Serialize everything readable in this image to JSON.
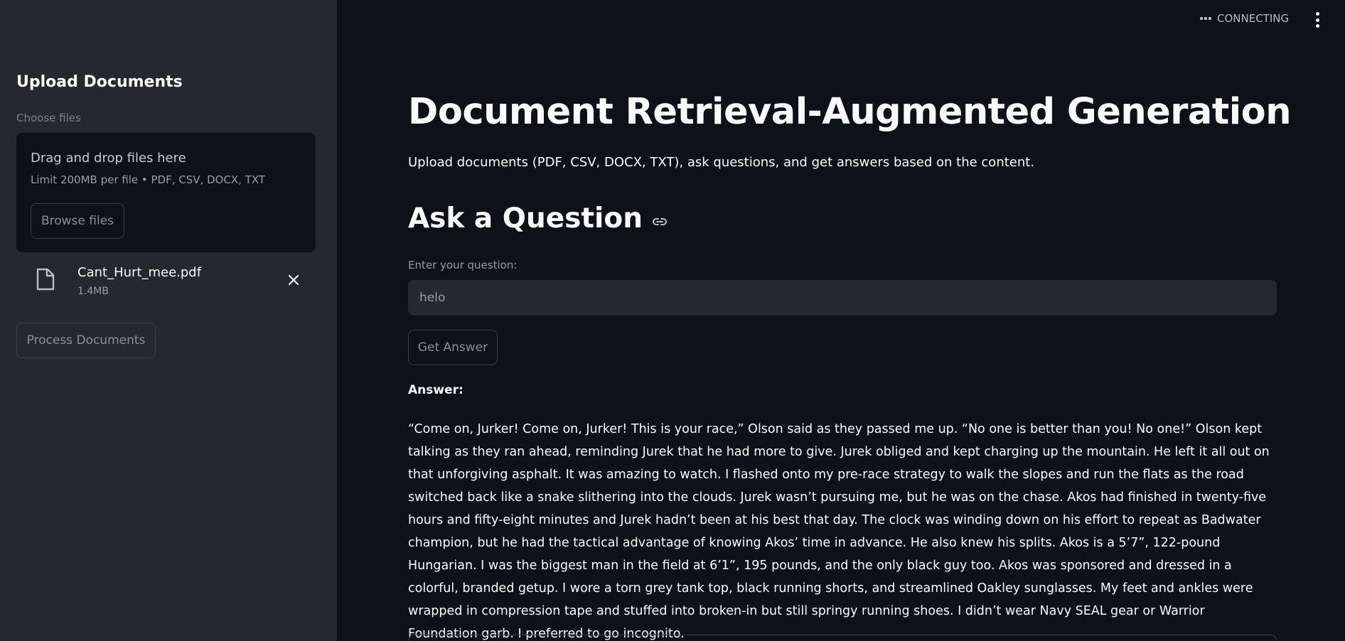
{
  "sidebar": {
    "title": "Upload Documents",
    "uploader_label": "Choose files",
    "dropzone": {
      "title": "Drag and drop files here",
      "subtitle": "Limit 200MB per file • PDF, CSV, DOCX, TXT",
      "browse_label": "Browse files"
    },
    "file": {
      "name": "Cant_Hurt_mee.pdf",
      "size": "1.4MB",
      "icon": "file-icon"
    },
    "process_label": "Process Documents"
  },
  "topbar": {
    "status": "CONNECTING"
  },
  "main": {
    "title": "Document Retrieval-Augmented Generation",
    "description": "Upload documents (PDF, CSV, DOCX, TXT), ask questions, and get answers based on the content.",
    "section_title": "Ask a Question",
    "question_label": "Enter your question:",
    "question_value": "helo",
    "get_answer_label": "Get Answer",
    "answer_label": "Answer:",
    "answer_text": "“Come on, Jurker! Come on, Jurker! This is your race,” Olson said as they passed me up. “No one is better than you! No one!” Olson kept talking as they ran ahead, reminding Jurek that he had more to give. Jurek obliged and kept charging up the mountain. He left it all out on that unforgiving asphalt. It was amazing to watch. I flashed onto my pre-race strategy to walk the slopes and run the flats as the road switched back like a snake slithering into the clouds. Jurek wasn’t pursuing me, but he was on the chase. Akos had finished in twenty-five hours and fifty-eight minutes and Jurek hadn’t been at his best that day. The clock was winding down on his effort to repeat as Badwater champion, but he had the tactical advantage of knowing Akos’ time in advance. He also knew his splits. Akos is a 5’7”, 122-pound Hungarian. I was the biggest man in the field at 6’1”, 195 pounds, and the only black guy too. Akos was sponsored and dressed in a colorful, branded getup. I wore a torn grey tank top, black running shorts, and streamlined Oakley sunglasses. My feet and ankles were wrapped in compression tape and stuffed into broken-in but still springy running shoes. I didn’t wear Navy SEAL gear or Warrior Foundation garb. I preferred to go incognito."
  },
  "colors": {
    "sidebar_bg": "#262730",
    "main_bg": "#0e1117",
    "text": "#fafafa",
    "muted": "#9a9ca6"
  }
}
